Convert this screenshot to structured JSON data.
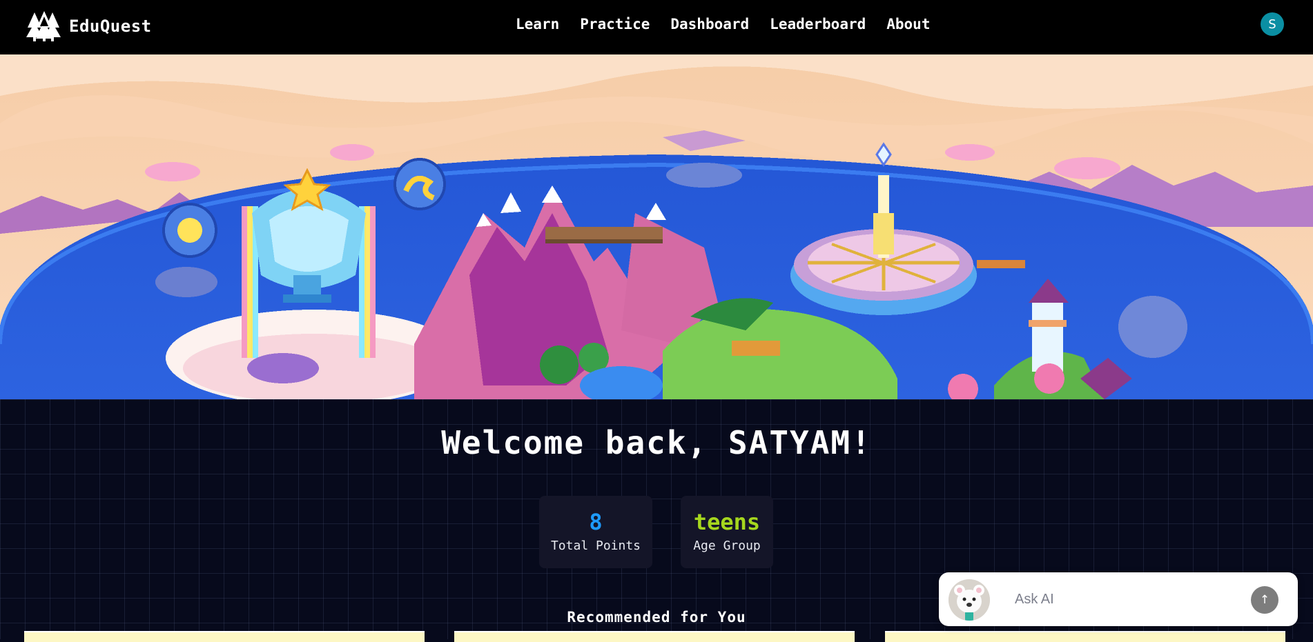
{
  "app": {
    "name": "EduQuest",
    "logo_icon": "pine-trees-icon"
  },
  "nav": {
    "links": [
      {
        "label": "Learn"
      },
      {
        "label": "Practice"
      },
      {
        "label": "Dashboard"
      },
      {
        "label": "Leaderboard"
      },
      {
        "label": "About"
      }
    ],
    "avatar_initial": "S"
  },
  "hero": {
    "scene": "pixel-art-fantasy-island-world"
  },
  "main": {
    "welcome": "Welcome back, SATYAM!",
    "stats": [
      {
        "value": "8",
        "label": "Total Points",
        "color": "#1e9bff"
      },
      {
        "value": "teens",
        "label": "Age Group",
        "color": "#a6d71e"
      }
    ],
    "recommended_title": "Recommended for You"
  },
  "ask_ai": {
    "placeholder": "Ask AI",
    "send_icon": "arrow-up-icon",
    "avatar_icon": "bear-mascot-icon"
  },
  "colors": {
    "nav_bg": "#000000",
    "page_bg": "#070a1c",
    "card_bg": "#141528",
    "avatar_bg": "#0b8fa3"
  }
}
